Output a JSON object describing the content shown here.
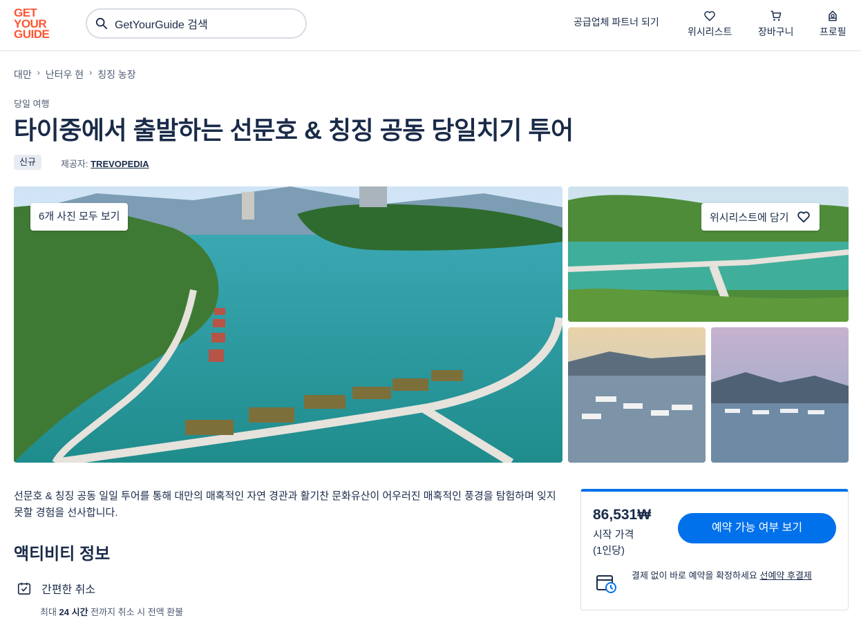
{
  "header": {
    "logo_lines": [
      "GET",
      "YOUR",
      "GUIDE"
    ],
    "search_placeholder": "GetYourGuide 검색",
    "supplier_link": "공급업체 파트너 되기",
    "wishlist": "위시리스트",
    "cart": "장바구니",
    "profile": "프로필"
  },
  "breadcrumb": [
    "대만",
    "난터우 현",
    "칭징 농장"
  ],
  "activity": {
    "category": "당일 여행",
    "title": "타이중에서 출발하는 선문호 & 칭징 공동 당일치기 투어",
    "badge": "신규",
    "provider_label": "제공자: ",
    "provider_name": "TREVOPEDIA"
  },
  "gallery": {
    "view_all": "6개 사진 모두 보기",
    "add_wishlist": "위시리스트에 담기"
  },
  "description": "선문호 & 칭징 공동 일일 투어를 통해 대만의 매혹적인 자연 경관과 활기찬 문화유산이 어우러진 매혹적인 풍경을 탐험하며 잊지 못할 경험을 선사합니다.",
  "info": {
    "title": "액티비티 정보",
    "cancellation_title": "간편한 취소",
    "cancellation_pre": "최대 ",
    "cancellation_bold": "24 시간",
    "cancellation_post": " 전까지 취소 시 전액 환불"
  },
  "booking": {
    "price": "86,531₩",
    "price_label": "시작 가격",
    "price_unit": "(1인당)",
    "check_button": "예약 가능 여부 보기",
    "reserve_text": "결제 없이 바로 예약을 확정하세요 ",
    "reserve_link": "선예약 후결제"
  },
  "colors": {
    "brand": "#ff5533",
    "accent": "#0071eb",
    "text": "#1a2b49"
  }
}
